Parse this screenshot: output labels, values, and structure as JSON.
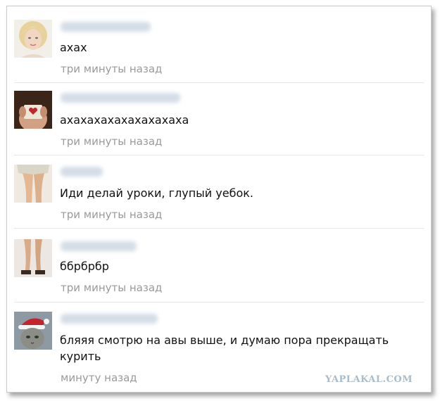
{
  "comments": [
    {
      "text": "ахах",
      "time": "три минуты назад",
      "avatar_icon": "avatar-blonde-woman-icon"
    },
    {
      "text": "ахахахахахахахахаха",
      "time": "три минуты назад",
      "avatar_icon": "avatar-heart-photo-icon"
    },
    {
      "text": "Иди делай уроки, глупый уебок.",
      "time": "три минуты назад",
      "avatar_icon": "avatar-legs-photo-icon"
    },
    {
      "text": "ббрбрбр",
      "time": "три минуты назад",
      "avatar_icon": "avatar-feet-photo-icon"
    },
    {
      "text": "бляяя смотрю на авы выше, и думаю пора прекращать курить",
      "time": "минуту назад",
      "avatar_icon": "avatar-santa-cat-icon"
    }
  ],
  "watermark": "YAPLAKAL.COM",
  "colors": {
    "name_blur": "#cdd7e2",
    "time": "#9a9a9a",
    "separator": "#e6e6e6",
    "watermark": "#a9bccb"
  }
}
